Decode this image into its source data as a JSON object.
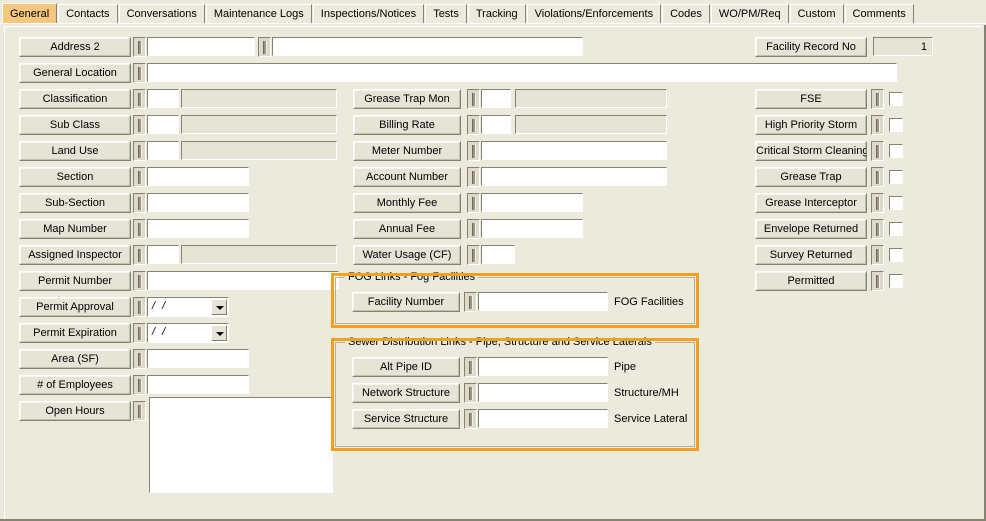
{
  "window": {
    "bg_color": "#ece9dd",
    "highlight_color": "#f2a01e",
    "active_tab_color": "#f5c77e"
  },
  "tabs": [
    {
      "label": "General",
      "active": true
    },
    {
      "label": "Contacts",
      "active": false
    },
    {
      "label": "Conversations",
      "active": false
    },
    {
      "label": "Maintenance Logs",
      "active": false
    },
    {
      "label": "Inspections/Notices",
      "active": false
    },
    {
      "label": "Tests",
      "active": false
    },
    {
      "label": "Tracking",
      "active": false
    },
    {
      "label": "Violations/Enforcements",
      "active": false
    },
    {
      "label": "Codes",
      "active": false
    },
    {
      "label": "WO/PM/Req",
      "active": false
    },
    {
      "label": "Custom",
      "active": false
    },
    {
      "label": "Comments",
      "active": false
    }
  ],
  "left_column": {
    "rows": [
      {
        "label": "Address 2",
        "value": "",
        "value2": ""
      },
      {
        "label": "General Location",
        "value": ""
      },
      {
        "label": "Classification",
        "value": "",
        "desc": ""
      },
      {
        "label": "Sub Class",
        "value": "",
        "desc": ""
      },
      {
        "label": "Land Use",
        "value": "",
        "desc": ""
      },
      {
        "label": "Section",
        "value": ""
      },
      {
        "label": "Sub-Section",
        "value": ""
      },
      {
        "label": "Map Number",
        "value": ""
      },
      {
        "label": "Assigned Inspector",
        "value": "",
        "desc": ""
      },
      {
        "label": "Permit Number",
        "value": ""
      },
      {
        "label": "Permit Approval",
        "value": "/  /"
      },
      {
        "label": "Permit Expiration",
        "value": "/  /"
      },
      {
        "label": "Area (SF)",
        "value": ""
      },
      {
        "label": "# of Employees",
        "value": ""
      },
      {
        "label": "Open Hours",
        "value": ""
      }
    ]
  },
  "middle_column": {
    "rows": [
      {
        "label": "Grease Trap Mon",
        "value": "",
        "desc": ""
      },
      {
        "label": "Billing Rate",
        "value": "",
        "desc": ""
      },
      {
        "label": "Meter Number",
        "value": ""
      },
      {
        "label": "Account Number",
        "value": ""
      },
      {
        "label": "Monthly Fee",
        "value": ""
      },
      {
        "label": "Annual Fee",
        "value": ""
      },
      {
        "label": "Water Usage (CF)",
        "value": ""
      }
    ]
  },
  "fog_group": {
    "title": "FOG Links - Fog Facilities",
    "highlighted": true,
    "rows": [
      {
        "label": "Facility Number",
        "value": "",
        "side_label": "FOG Facilities"
      }
    ]
  },
  "sewer_group": {
    "title": "Sewer Distribution Links - Pipe, Structure and Service Laterals",
    "highlighted": true,
    "rows": [
      {
        "label": "Alt Pipe ID",
        "value": "",
        "side_label": "Pipe"
      },
      {
        "label": "Network Structure",
        "value": "",
        "side_label": "Structure/MH"
      },
      {
        "label": "Service Structure",
        "value": "",
        "side_label": "Service Lateral"
      }
    ]
  },
  "right_column": {
    "record": {
      "label": "Facility Record No",
      "value": "1"
    },
    "checkbox_rows": [
      {
        "label": "FSE",
        "checked": false
      },
      {
        "label": "High Priority Storm",
        "checked": false
      },
      {
        "label": "Critical Storm Cleaning",
        "checked": false
      },
      {
        "label": "Grease Trap",
        "checked": false
      },
      {
        "label": "Grease Interceptor",
        "checked": false
      },
      {
        "label": "Envelope Returned",
        "checked": false
      },
      {
        "label": "Survey Returned",
        "checked": false
      },
      {
        "label": "Permitted",
        "checked": false
      }
    ]
  }
}
